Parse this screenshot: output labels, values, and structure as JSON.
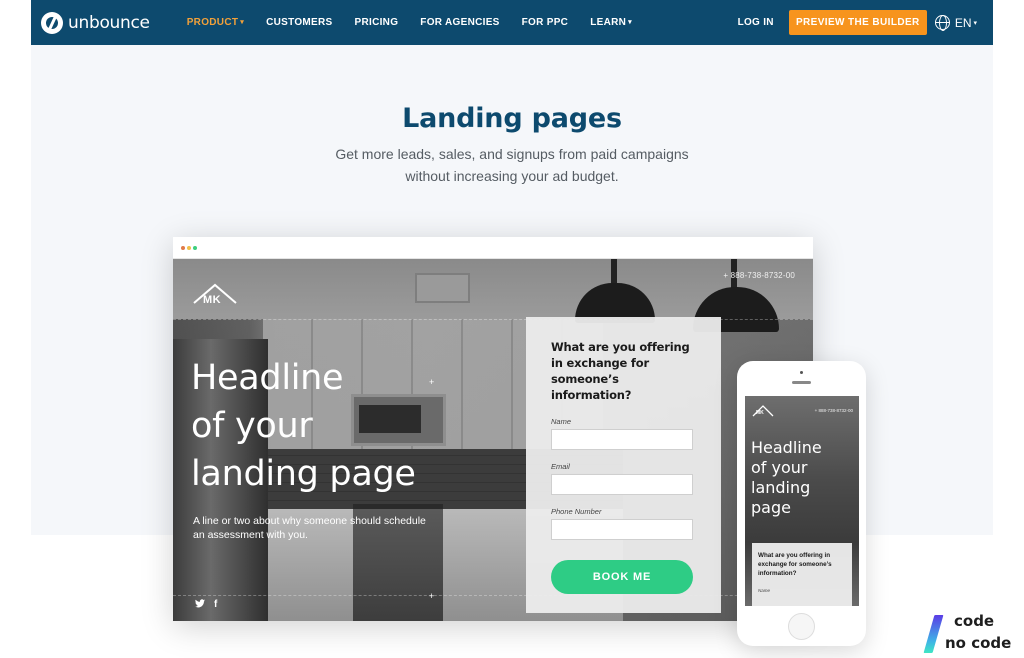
{
  "nav": {
    "logo_text": "unbounce",
    "items": [
      {
        "label": "PRODUCT",
        "has_dropdown": true,
        "active": true
      },
      {
        "label": "CUSTOMERS",
        "has_dropdown": false,
        "active": false
      },
      {
        "label": "PRICING",
        "has_dropdown": false,
        "active": false
      },
      {
        "label": "FOR AGENCIES",
        "has_dropdown": false,
        "active": false
      },
      {
        "label": "FOR PPC",
        "has_dropdown": false,
        "active": false
      },
      {
        "label": "LEARN",
        "has_dropdown": true,
        "active": false
      }
    ],
    "login_label": "LOG IN",
    "cta_label": "PREVIEW THE BUILDER",
    "language": "EN",
    "caret": "▾"
  },
  "hero": {
    "title": "Landing pages",
    "subtitle_line1": "Get more leads, sales, and signups from paid campaigns",
    "subtitle_line2": "without increasing your ad budget."
  },
  "desktop_mock": {
    "logo_text": "MK",
    "phone_number": "+ 888-738-8732-00",
    "headline_line1": "Headline",
    "headline_line2": "of your",
    "headline_line3": "landing page",
    "subline": "A line or two about why someone should schedule an assessment with you.",
    "social": {
      "twitter": "🐦",
      "facebook": "f"
    },
    "form": {
      "question": "What are you offering in exchange for someone’s information?",
      "fields": [
        {
          "label": "Name",
          "value": ""
        },
        {
          "label": "Email",
          "value": ""
        },
        {
          "label": "Phone Number",
          "value": ""
        }
      ],
      "button_label": "BOOK ME"
    },
    "window_dots": [
      "#e07b4a",
      "#f2c14a",
      "#3ecf7e"
    ]
  },
  "mobile_mock": {
    "logo_text": "MK",
    "phone_number": "+ 888-738-8732-00",
    "headline_line1": "Headline",
    "headline_line2": "of your",
    "headline_line3": "landing",
    "headline_line4": "page",
    "form_question": "What are you offering in exchange for someone’s information?",
    "name_label": "Name"
  },
  "watermark": {
    "line1": "code",
    "line2": "no code"
  },
  "colors": {
    "nav_bg": "#0d4a6e",
    "accent_orange": "#f7941d",
    "title_blue": "#0d4a6e",
    "cta_green": "#2ecc85"
  }
}
